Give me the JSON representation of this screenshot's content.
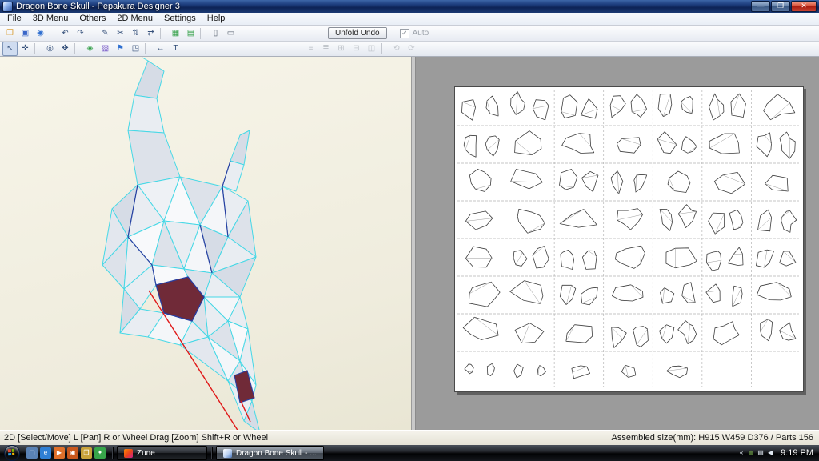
{
  "window": {
    "title": "Dragon Bone Skull - Pepakura Designer 3",
    "controls": [
      {
        "name": "minimize",
        "glyph": "—"
      },
      {
        "name": "maximize",
        "glyph": "❐"
      },
      {
        "name": "close",
        "glyph": "✕"
      }
    ]
  },
  "menubar": {
    "items": [
      "File",
      "3D Menu",
      "Others",
      "2D Menu",
      "Settings",
      "Help"
    ]
  },
  "toolbars": {
    "unfold_undo_label": "Unfold Undo",
    "auto_label": "Auto",
    "auto_check": "✓",
    "row1": [
      {
        "name": "open-folder",
        "glyph": "❒",
        "color": "#d9a03a"
      },
      {
        "name": "save",
        "glyph": "▣",
        "color": "#3a66c8"
      },
      {
        "name": "export-globe",
        "glyph": "◉",
        "color": "#2f6fd0"
      },
      {
        "sep": true
      },
      {
        "name": "undo",
        "glyph": "↶"
      },
      {
        "name": "redo",
        "glyph": "↷"
      },
      {
        "sep": true
      },
      {
        "name": "pen",
        "glyph": "✎"
      },
      {
        "name": "scissors",
        "glyph": "✂"
      },
      {
        "name": "flip-vertical",
        "glyph": "⇅"
      },
      {
        "name": "flip-horizontal",
        "glyph": "⇄"
      },
      {
        "sep": true
      },
      {
        "name": "grid-view",
        "glyph": "▦",
        "color": "#2f9e44"
      },
      {
        "name": "table-view",
        "glyph": "▤",
        "color": "#2f9e44"
      },
      {
        "sep": true
      },
      {
        "name": "page-portrait",
        "glyph": "▯",
        "color": "#56606e"
      },
      {
        "name": "page-landscape",
        "glyph": "▭",
        "color": "#56606e"
      }
    ],
    "row2": [
      {
        "name": "select-move",
        "glyph": "↖",
        "pressed": true
      },
      {
        "name": "edit-vertex",
        "glyph": "✛"
      },
      {
        "sep": true
      },
      {
        "name": "zoom",
        "glyph": "◎"
      },
      {
        "name": "pan",
        "glyph": "✥"
      },
      {
        "sep": true
      },
      {
        "name": "solid-cube",
        "glyph": "◈",
        "color": "#2f9e44"
      },
      {
        "name": "texture",
        "glyph": "▨",
        "color": "#7a5cc9"
      },
      {
        "name": "flag-mark",
        "glyph": "⚑",
        "color": "#2f6fd0"
      },
      {
        "name": "stamp",
        "glyph": "◳"
      },
      {
        "sep": true
      },
      {
        "name": "measure",
        "glyph": "↔"
      },
      {
        "name": "text-tool",
        "glyph": "T"
      }
    ],
    "row2_right": [
      {
        "name": "align-left",
        "glyph": "≡",
        "disabled": true
      },
      {
        "name": "align-center",
        "glyph": "≣",
        "disabled": true
      },
      {
        "name": "join-parts",
        "glyph": "⊞",
        "disabled": true
      },
      {
        "name": "divide-parts",
        "glyph": "⊟",
        "disabled": true
      },
      {
        "name": "arrange-parts",
        "glyph": "◫",
        "disabled": true
      },
      {
        "sep": true
      },
      {
        "name": "rotate-left",
        "glyph": "⟲",
        "disabled": true
      },
      {
        "name": "rotate-right",
        "glyph": "⟳",
        "disabled": true
      }
    ]
  },
  "view2d": {
    "grid_rows": 8,
    "grid_cols": 7,
    "last_row_pieces": 5
  },
  "statusbar": {
    "hint": "2D [Select/Move] L [Pan] R or Wheel Drag [Zoom] Shift+R or Wheel",
    "assembled": "Assembled size(mm): H915 W459 D376 / Parts 156"
  },
  "taskbar": {
    "quicklaunch": [
      {
        "name": "show-desktop",
        "glyph": "▢",
        "bg": "#5a82b5"
      },
      {
        "name": "internet-explorer",
        "glyph": "e",
        "bg": "#2f7fd4"
      },
      {
        "name": "media-player",
        "glyph": "▶",
        "bg": "#e0702a"
      },
      {
        "name": "firefox",
        "glyph": "◉",
        "bg": "#c8571d"
      },
      {
        "name": "folder-explorer",
        "glyph": "❒",
        "bg": "#c8a23a"
      },
      {
        "name": "messenger",
        "glyph": "✦",
        "bg": "#37a54a"
      }
    ],
    "tasks": [
      {
        "name": "zune",
        "label": "Zune"
      },
      {
        "name": "pepakura",
        "label": "Dragon Bone Skull - ..."
      }
    ],
    "tray": [
      {
        "name": "hidden-icons",
        "glyph": "«"
      },
      {
        "name": "update",
        "glyph": "◍",
        "color": "#8fce5a"
      },
      {
        "name": "network",
        "glyph": "▤"
      },
      {
        "name": "volume",
        "glyph": "◀"
      }
    ],
    "clock": "9:19 PM"
  }
}
